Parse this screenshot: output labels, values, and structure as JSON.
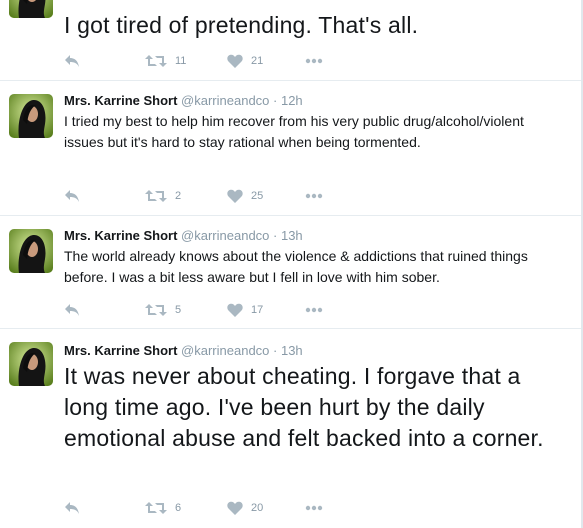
{
  "colors": {
    "name": "#14171a",
    "muted": "#8899a6",
    "icon": "#aab8c2",
    "divider": "#e6ecf0"
  },
  "icons": [
    "reply-icon",
    "retweet-icon",
    "like-icon",
    "more-icon"
  ],
  "tweets": [
    {
      "name": "",
      "handle": "",
      "time": "",
      "text": "I got tired of pretending. That's all.",
      "retweets": "11",
      "likes": "21"
    },
    {
      "name": "Mrs. Karrine Short",
      "handle": "@karrineandco",
      "time": " · 12h",
      "text": "I tried my best to help him recover from his very public drug/alcohol/violent issues but it's hard to stay rational when being tormented.",
      "retweets": "2",
      "likes": "25"
    },
    {
      "name": "Mrs. Karrine Short",
      "handle": "@karrineandco",
      "time": " · 13h",
      "text": "The world already knows about the violence & addictions that ruined things before. I was a bit less aware but I fell in love with him sober.",
      "retweets": "5",
      "likes": "17"
    },
    {
      "name": "Mrs. Karrine Short",
      "handle": "@karrineandco",
      "time": " · 13h",
      "text": "It was never about cheating. I forgave that a long time ago. I've been hurt by the daily emotional abuse and felt backed into a corner.",
      "retweets": "6",
      "likes": "20"
    }
  ]
}
